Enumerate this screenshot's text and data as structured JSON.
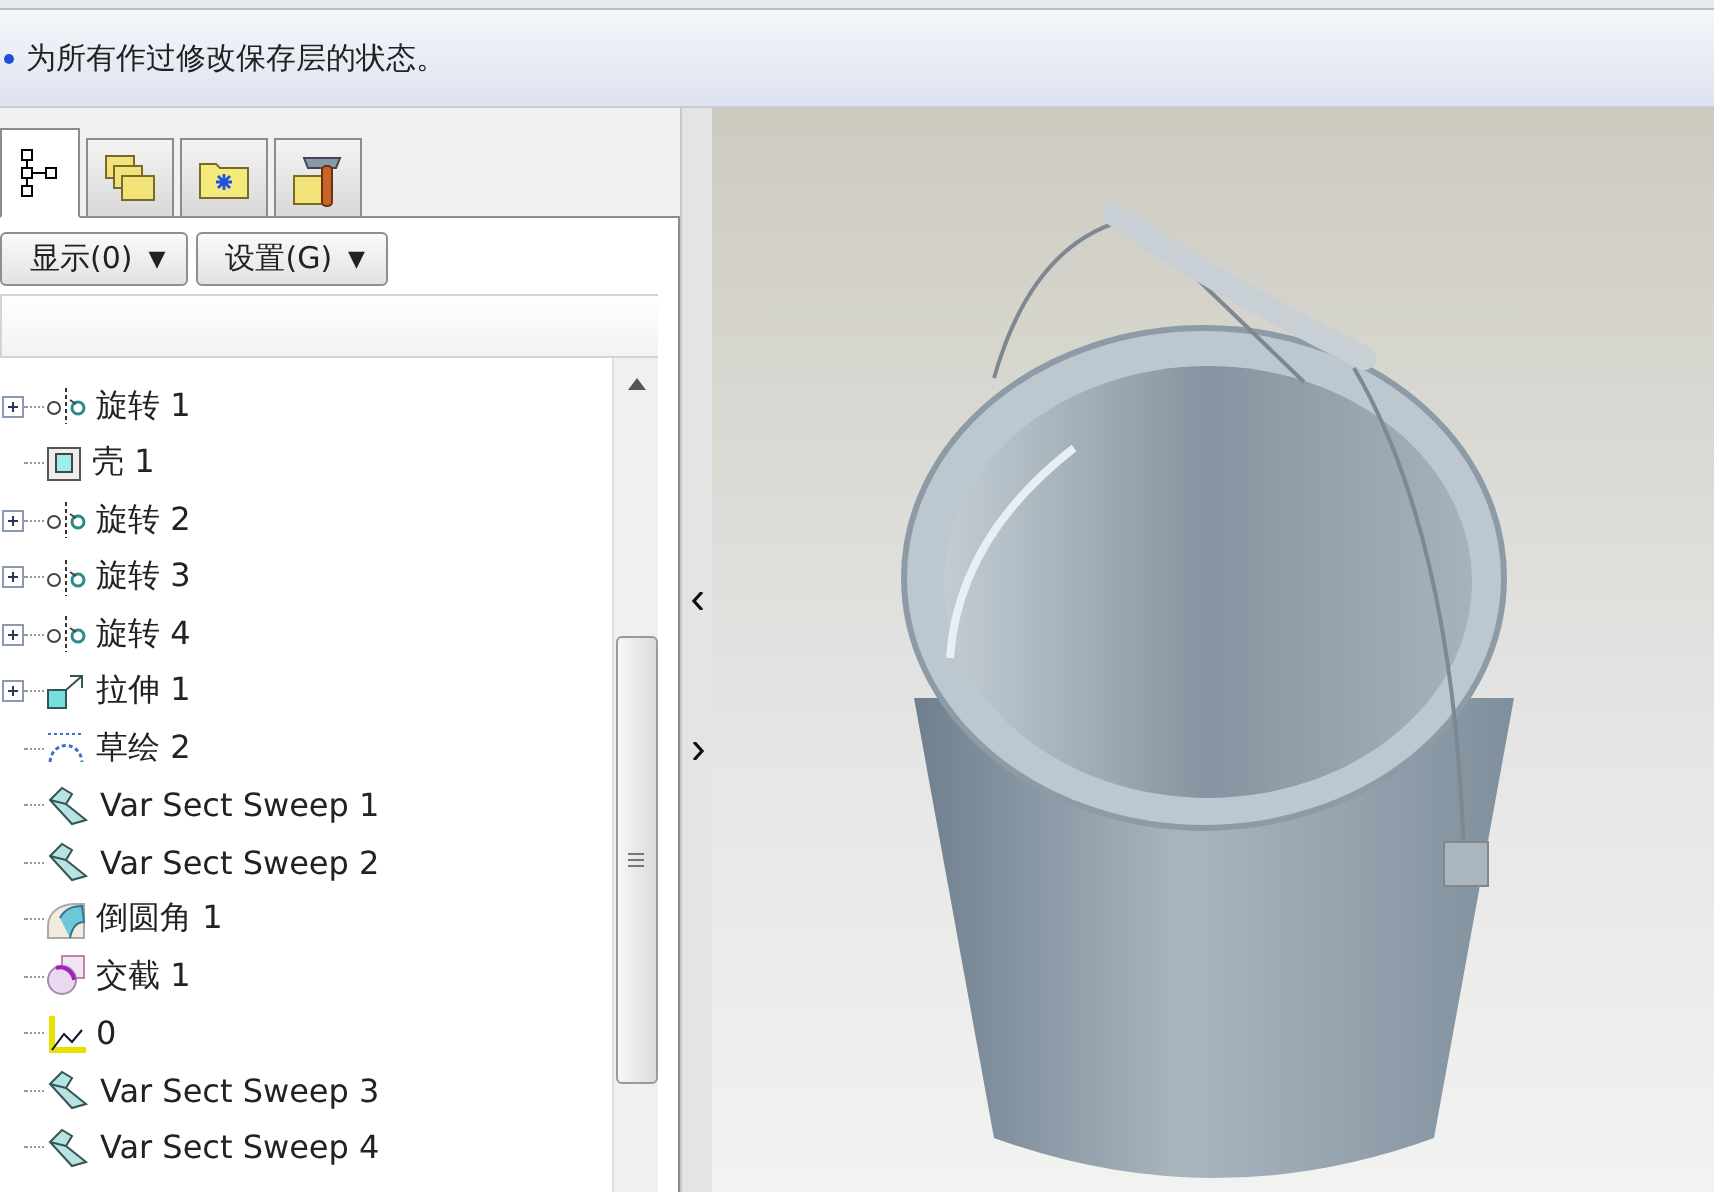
{
  "message_bar": {
    "text": "为所有作过修改保存层的状态。"
  },
  "tabs": [
    {
      "kind": "tree",
      "selected": true
    },
    {
      "kind": "layers",
      "selected": false
    },
    {
      "kind": "folder",
      "selected": false
    },
    {
      "kind": "tools",
      "selected": false
    }
  ],
  "toolbar": [
    {
      "label": "显示(0)",
      "caret": "▼"
    },
    {
      "label": "设置(G)",
      "caret": "▼"
    }
  ],
  "tree": [
    {
      "label": "旋转 1",
      "kind": "revolve",
      "expandable": true
    },
    {
      "label": "壳 1",
      "kind": "shell",
      "expandable": false
    },
    {
      "label": "旋转 2",
      "kind": "revolve",
      "expandable": true
    },
    {
      "label": "旋转 3",
      "kind": "revolve",
      "expandable": true
    },
    {
      "label": "旋转 4",
      "kind": "revolve",
      "expandable": true
    },
    {
      "label": "拉伸 1",
      "kind": "extrude",
      "expandable": true
    },
    {
      "label": "草绘 2",
      "kind": "sketch",
      "expandable": false
    },
    {
      "label": "Var Sect Sweep 1",
      "kind": "sweep",
      "expandable": false
    },
    {
      "label": "Var Sect Sweep 2",
      "kind": "sweep",
      "expandable": false
    },
    {
      "label": "倒圆角 1",
      "kind": "round",
      "expandable": false
    },
    {
      "label": "交截 1",
      "kind": "intersect",
      "expandable": false
    },
    {
      "label": "0",
      "kind": "csys",
      "expandable": false
    },
    {
      "label": "Var Sect Sweep 3",
      "kind": "sweep",
      "expandable": false
    },
    {
      "label": "Var Sect Sweep 4",
      "kind": "sweep",
      "expandable": false
    }
  ]
}
